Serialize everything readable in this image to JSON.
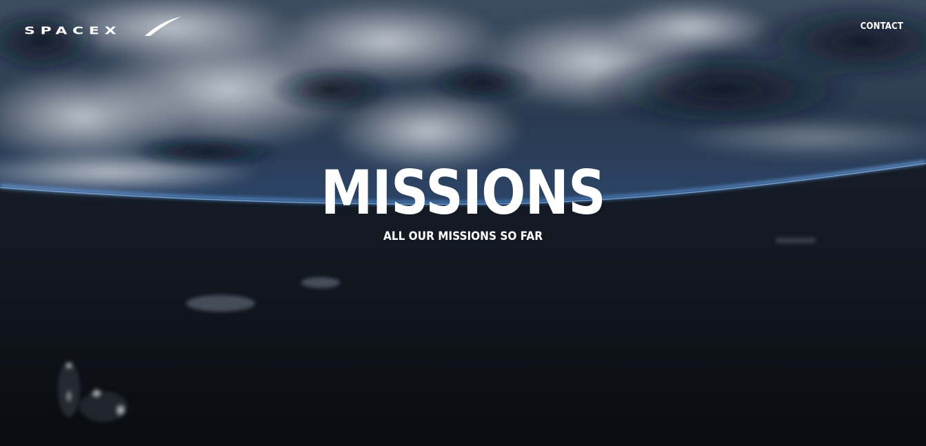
{
  "header": {
    "logo_text": "SPACEX",
    "logo_icon": "spacex-logo-icon",
    "nav": {
      "contact_label": "CONTACT"
    }
  },
  "hero": {
    "title": "MISSIONS",
    "subtitle": "ALL OUR MISSIONS SO FAR",
    "background": "earth-from-orbit-image"
  },
  "colors": {
    "text": "#ffffff",
    "background": "#0a0d13",
    "atmosphere": "#4a8bd6"
  }
}
